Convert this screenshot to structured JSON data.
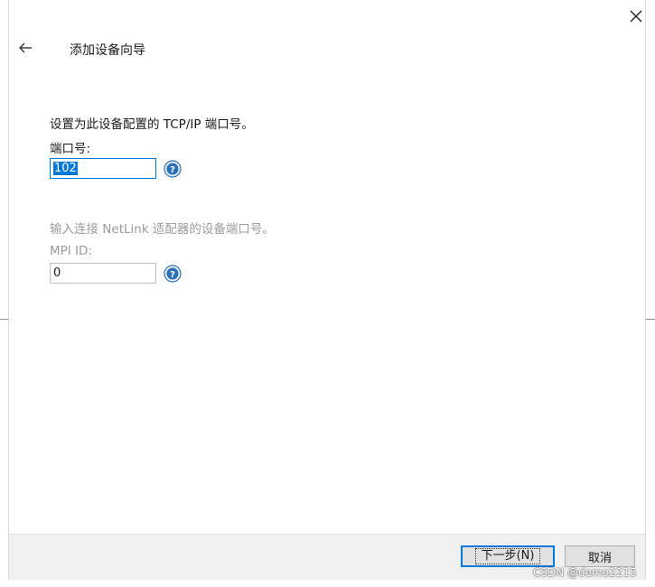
{
  "dialog": {
    "title": "添加设备向导",
    "close_glyph": "✕",
    "back_glyph": "←"
  },
  "tcp_section": {
    "description": "设置为此设备配置的 TCP/IP 端口号。",
    "port_label": "端口号:",
    "port_value": "102"
  },
  "mpi_section": {
    "description": "输入连接 NetLink 适配器的设备端口号。",
    "mpi_label": "MPI ID:",
    "mpi_value": "0"
  },
  "footer": {
    "next_label": "下一步(N)",
    "cancel_label": "取消"
  },
  "watermark": "CSDN @demo2215",
  "colors": {
    "accent": "#0078d7",
    "help_icon": "#2b6fb6",
    "footer_bg": "#f0f0f0",
    "disabled_text": "#9a9a9a"
  },
  "icons": {
    "close": "close-icon",
    "back": "back-arrow-icon",
    "help": "help-question-icon"
  }
}
